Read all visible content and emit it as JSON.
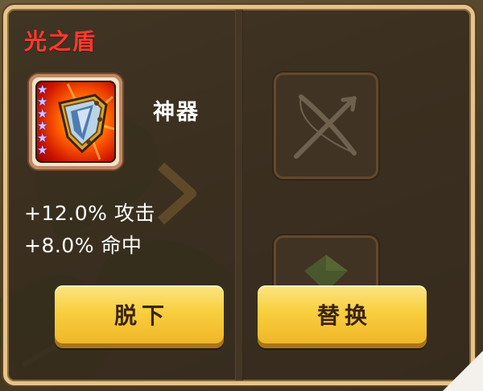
{
  "equipment_panel": {
    "title": "光之盾",
    "item": {
      "icon": "light-shield-icon",
      "star_count": 6,
      "star_glyph": "★",
      "type_label": "神器"
    },
    "stats": [
      {
        "text": "+12.0% 攻击"
      },
      {
        "text": "+8.0% 命中"
      }
    ],
    "buttons": {
      "unequip_label": "脱下",
      "replace_label": "替换"
    },
    "background_slots": [
      {
        "icon": "crossed-bow-arrow-icon"
      },
      {
        "icon": "green-gem-icon"
      }
    ]
  },
  "colors": {
    "title": "#ff3a2e",
    "button_fill": "#f8cf3e",
    "button_text": "#3a2410",
    "panel_border": "#e4c48c",
    "star": "#d7c2ff"
  }
}
